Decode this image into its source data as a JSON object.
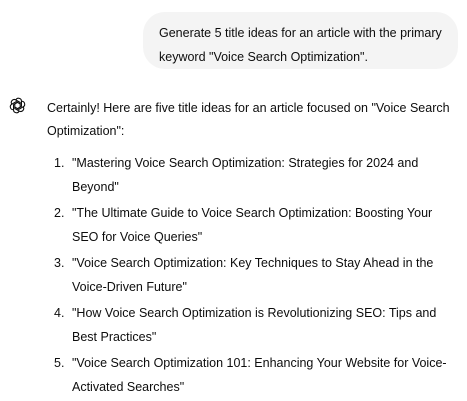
{
  "user_message": "Generate 5 title ideas for an article with the primary keyword \"Voice Search Optimization\".",
  "assistant": {
    "avatar_icon": "openai-logo-icon",
    "intro": "Certainly! Here are five title ideas for an article focused on \"Voice Search Optimization\":",
    "titles": [
      {
        "num": "1.",
        "text": "\"Mastering Voice Search Optimization: Strategies for 2024 and Beyond\""
      },
      {
        "num": "2.",
        "text": "\"The Ultimate Guide to Voice Search Optimization: Boosting Your SEO for Voice Queries\""
      },
      {
        "num": "3.",
        "text": "\"Voice Search Optimization: Key Techniques to Stay Ahead in the Voice-Driven Future\""
      },
      {
        "num": "4.",
        "text": "\"How Voice Search Optimization is Revolutionizing SEO: Tips and Best Practices\""
      },
      {
        "num": "5.",
        "text": "\"Voice Search Optimization 101: Enhancing Your Website for Voice-Activated Searches\""
      }
    ]
  }
}
